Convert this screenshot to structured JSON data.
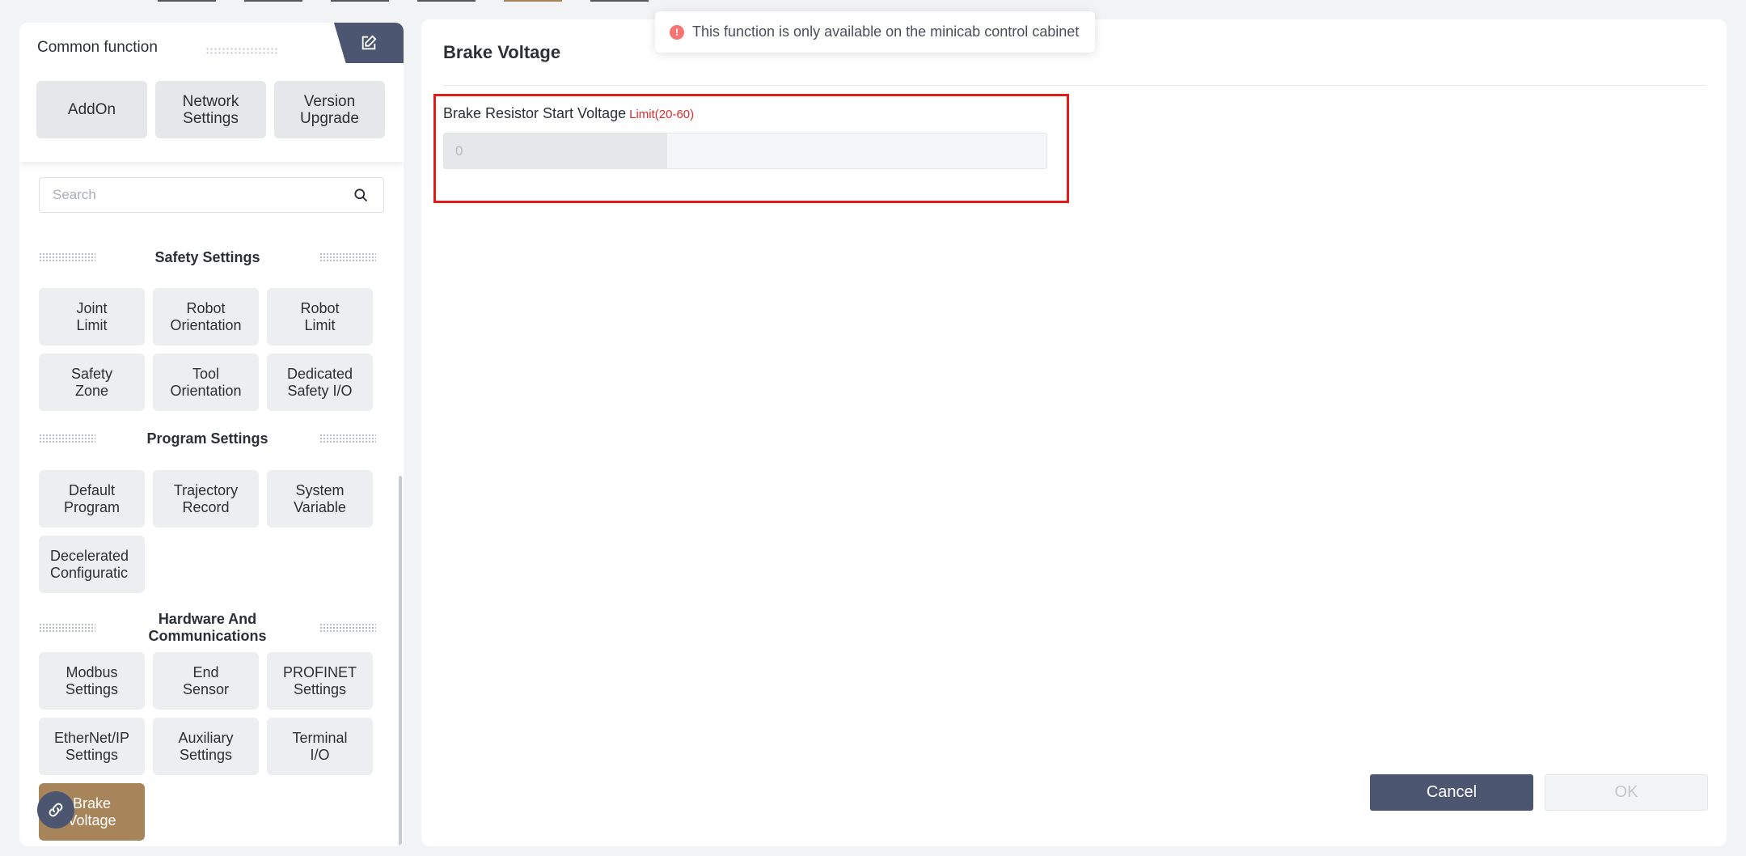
{
  "common_function": {
    "title": "Common function",
    "buttons": [
      {
        "label": "AddOn"
      },
      {
        "label": "Network\nSettings"
      },
      {
        "label": "Version\nUpgrade"
      }
    ]
  },
  "search": {
    "placeholder": "Search"
  },
  "sections": [
    {
      "title": "Safety Settings",
      "items": [
        {
          "label": "Joint\nLimit"
        },
        {
          "label": "Robot\nOrientation"
        },
        {
          "label": "Robot\nLimit"
        },
        {
          "label": "Safety\nZone"
        },
        {
          "label": "Tool\nOrientation"
        },
        {
          "label": "Dedicated\nSafety I/O"
        }
      ]
    },
    {
      "title": "Program Settings",
      "items": [
        {
          "label": "Default\nProgram"
        },
        {
          "label": "Trajectory\nRecord"
        },
        {
          "label": "System\nVariable"
        },
        {
          "label": "Decelerated\nConfiguratic"
        }
      ]
    },
    {
      "title": "Hardware And\nCommunications",
      "items": [
        {
          "label": "Modbus\nSettings"
        },
        {
          "label": "End\nSensor"
        },
        {
          "label": "PROFINET\nSettings"
        },
        {
          "label": "EtherNet/IP\nSettings"
        },
        {
          "label": "Auxiliary\nSettings"
        },
        {
          "label": "Terminal\nI/O"
        },
        {
          "label": "Brake\nVoltage"
        }
      ]
    }
  ],
  "main": {
    "title": "Brake Voltage",
    "field": {
      "label": "Brake Resistor Start Voltage",
      "limit": "Limit(20-60)",
      "value": "0"
    },
    "cancel_label": "Cancel",
    "ok_label": "OK"
  },
  "toast": {
    "icon": "exclamation-icon",
    "text": "This function is only available on the minicab control cabinet"
  },
  "colors": {
    "accent": "#4d5670",
    "active_item": "#a8845a",
    "highlight_border": "#e21b1b",
    "limit_text": "#e02b2b"
  }
}
